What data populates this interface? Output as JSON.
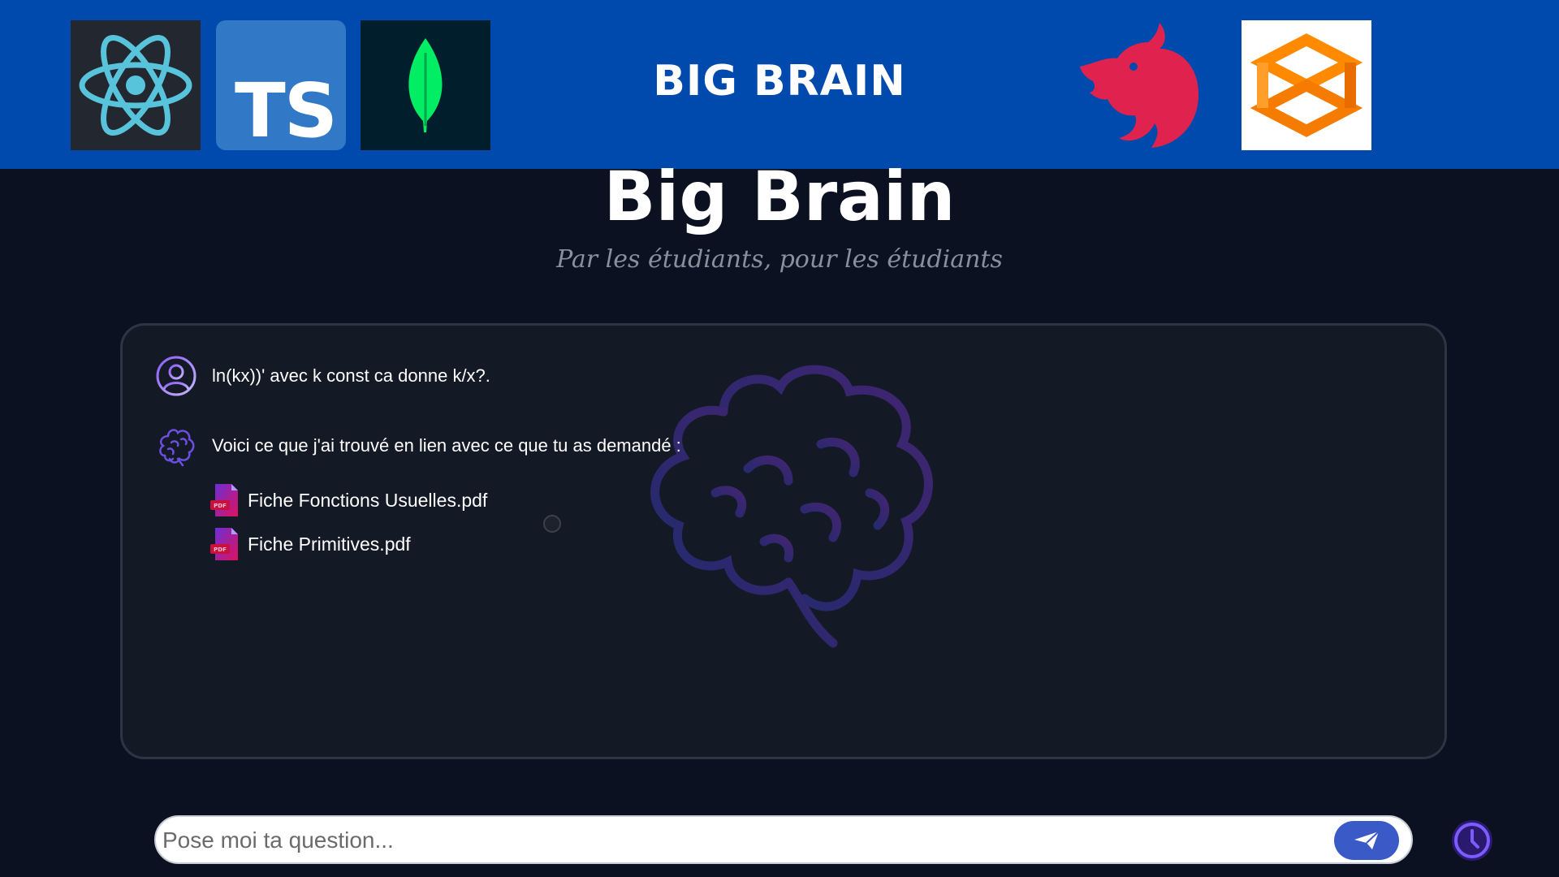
{
  "banner": {
    "title": "BIG BRAIN",
    "ts_logo_text": "TS",
    "logos": [
      "react-logo",
      "typescript-logo",
      "mongodb-logo",
      "nestjs-logo",
      "stackblitz-logo"
    ]
  },
  "hero": {
    "title": "Big Brain",
    "subtitle": "Par les étudiants, pour les étudiants"
  },
  "chat": {
    "user_message": "ln(kx))' avec k const ca donne k/x?.",
    "bot_message": "Voici ce que j'ai trouvé en lien avec ce que tu as demandé :",
    "documents": [
      {
        "name": "Fiche Fonctions Usuelles.pdf",
        "icon": "pdf-icon"
      },
      {
        "name": "Fiche Primitives.pdf",
        "icon": "pdf-icon"
      }
    ]
  },
  "input": {
    "placeholder": "Pose moi ta question...",
    "value": ""
  },
  "icons": {
    "send": "send-icon",
    "history": "clock-icon",
    "user_avatar": "user-icon",
    "bot_avatar": "brain-icon"
  },
  "colors": {
    "banner_bg": "#004aad",
    "page_bg": "#0b1120",
    "panel_bg": "#141926",
    "accent": "#3a5bc7",
    "brain_purple": "#6a3fd0"
  }
}
